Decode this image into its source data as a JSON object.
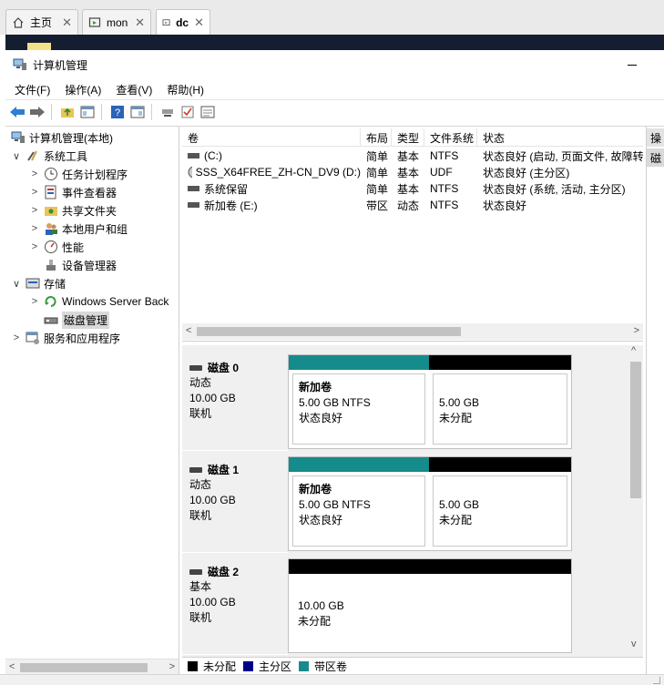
{
  "browser": {
    "tabs": [
      {
        "label": "主页",
        "icon": "home-icon"
      },
      {
        "label": "mon",
        "icon": "vm-icon"
      },
      {
        "label": "dc",
        "icon": "vm-icon"
      }
    ],
    "close_glyph": "✕"
  },
  "window": {
    "title": "计算机管理",
    "minimize_glyph": "—"
  },
  "menu": {
    "items": [
      "文件(F)",
      "操作(A)",
      "查看(V)",
      "帮助(H)"
    ]
  },
  "toolbar": {
    "buttons": [
      "back-icon",
      "forward-icon",
      "up-folder-icon",
      "show-hide-tree-icon",
      "help-icon",
      "show-hide-action-icon",
      "connect-icon",
      "check-icon",
      "properties-icon"
    ]
  },
  "tree": {
    "items": [
      {
        "label": "计算机管理(本地)",
        "expander": "",
        "icon": "computer-management-icon",
        "level": 0
      },
      {
        "label": "系统工具",
        "expander": "∨",
        "icon": "tools-icon",
        "level": 1
      },
      {
        "label": "任务计划程序",
        "expander": ">",
        "icon": "clock-icon",
        "level": 2
      },
      {
        "label": "事件查看器",
        "expander": ">",
        "icon": "event-viewer-icon",
        "level": 2
      },
      {
        "label": "共享文件夹",
        "expander": ">",
        "icon": "shared-folder-icon",
        "level": 2
      },
      {
        "label": "本地用户和组",
        "expander": ">",
        "icon": "users-icon",
        "level": 2
      },
      {
        "label": "性能",
        "expander": ">",
        "icon": "performance-icon",
        "level": 2
      },
      {
        "label": "设备管理器",
        "expander": "",
        "icon": "device-manager-icon",
        "level": 2
      },
      {
        "label": "存储",
        "expander": "∨",
        "icon": "storage-icon",
        "level": 1
      },
      {
        "label": "Windows Server Back",
        "expander": ">",
        "icon": "backup-icon",
        "level": 2
      },
      {
        "label": "磁盘管理",
        "expander": "",
        "icon": "disk-icon",
        "level": 2,
        "selected": true
      },
      {
        "label": "服务和应用程序",
        "expander": ">",
        "icon": "services-icon",
        "level": 1
      }
    ]
  },
  "volumes": {
    "columns": [
      "卷",
      "布局",
      "类型",
      "文件系统",
      "状态"
    ],
    "rows": [
      {
        "name": "(C:)",
        "layout": "简单",
        "type": "基本",
        "fs": "NTFS",
        "status": "状态良好 (启动, 页面文件, 故障转"
      },
      {
        "name": "SSS_X64FREE_ZH-CN_DV9 (D:)",
        "layout": "简单",
        "type": "基本",
        "fs": "UDF",
        "status": "状态良好 (主分区)"
      },
      {
        "name": "系统保留",
        "layout": "简单",
        "type": "基本",
        "fs": "NTFS",
        "status": "状态良好 (系统, 活动, 主分区)"
      },
      {
        "name": "新加卷 (E:)",
        "layout": "带区",
        "type": "动态",
        "fs": "NTFS",
        "status": "状态良好"
      }
    ]
  },
  "disks": [
    {
      "name": "磁盘 0",
      "kind": "动态",
      "size": "10.00 GB",
      "state": "联机",
      "parts": [
        {
          "name": "新加卷",
          "size": "5.00 GB NTFS",
          "status": "状态良好",
          "color": "#158b8b"
        },
        {
          "name": "",
          "size": "5.00 GB",
          "status": "未分配",
          "color": "#000000"
        }
      ]
    },
    {
      "name": "磁盘 1",
      "kind": "动态",
      "size": "10.00 GB",
      "state": "联机",
      "parts": [
        {
          "name": "新加卷",
          "size": "5.00 GB NTFS",
          "status": "状态良好",
          "color": "#158b8b"
        },
        {
          "name": "",
          "size": "5.00 GB",
          "status": "未分配",
          "color": "#000000"
        }
      ]
    },
    {
      "name": "磁盘 2",
      "kind": "基本",
      "size": "10.00 GB",
      "state": "联机",
      "parts": [
        {
          "name": "",
          "size": "10.00 GB",
          "status": "未分配",
          "color": "#000000"
        }
      ]
    }
  ],
  "legend": [
    {
      "label": "未分配",
      "color": "#000000"
    },
    {
      "label": "主分区",
      "color": "#00008b"
    },
    {
      "label": "带区卷",
      "color": "#158b8b"
    }
  ],
  "actions": {
    "header": "操",
    "item": "磁"
  },
  "scroll": {
    "left": "<",
    "right": ">",
    "up": "^",
    "down": "v"
  }
}
